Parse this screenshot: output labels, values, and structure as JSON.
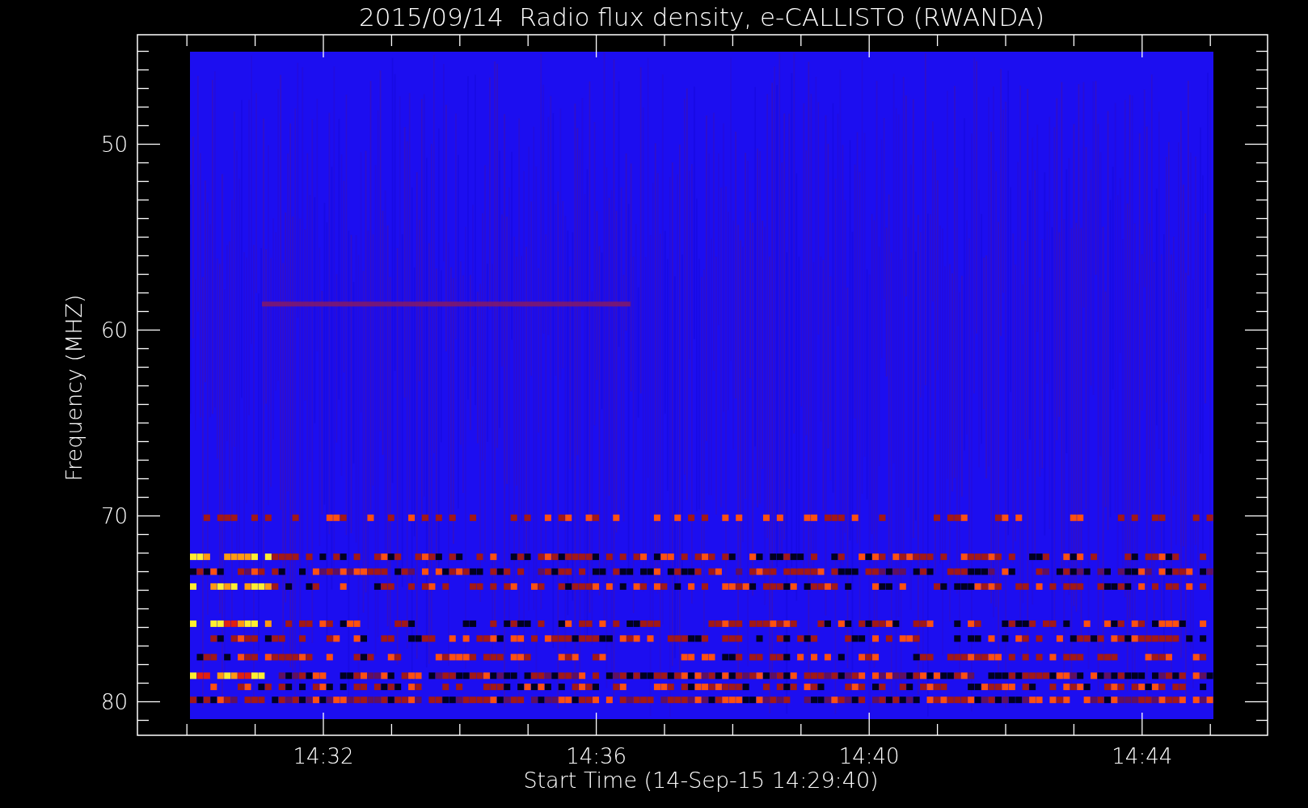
{
  "plot": {
    "title": "2015/09/14  Radio flux density, e-CALLISTO (RWANDA)",
    "y_axis": {
      "label": "Frequency (MHZ)",
      "ticks": [
        "50",
        "60",
        "70",
        "80"
      ]
    },
    "x_axis": {
      "label": "Start Time (14-Sep-15 14:29:40)",
      "ticks": [
        "14:32",
        "14:36",
        "14:40",
        "14:44"
      ]
    }
  }
}
